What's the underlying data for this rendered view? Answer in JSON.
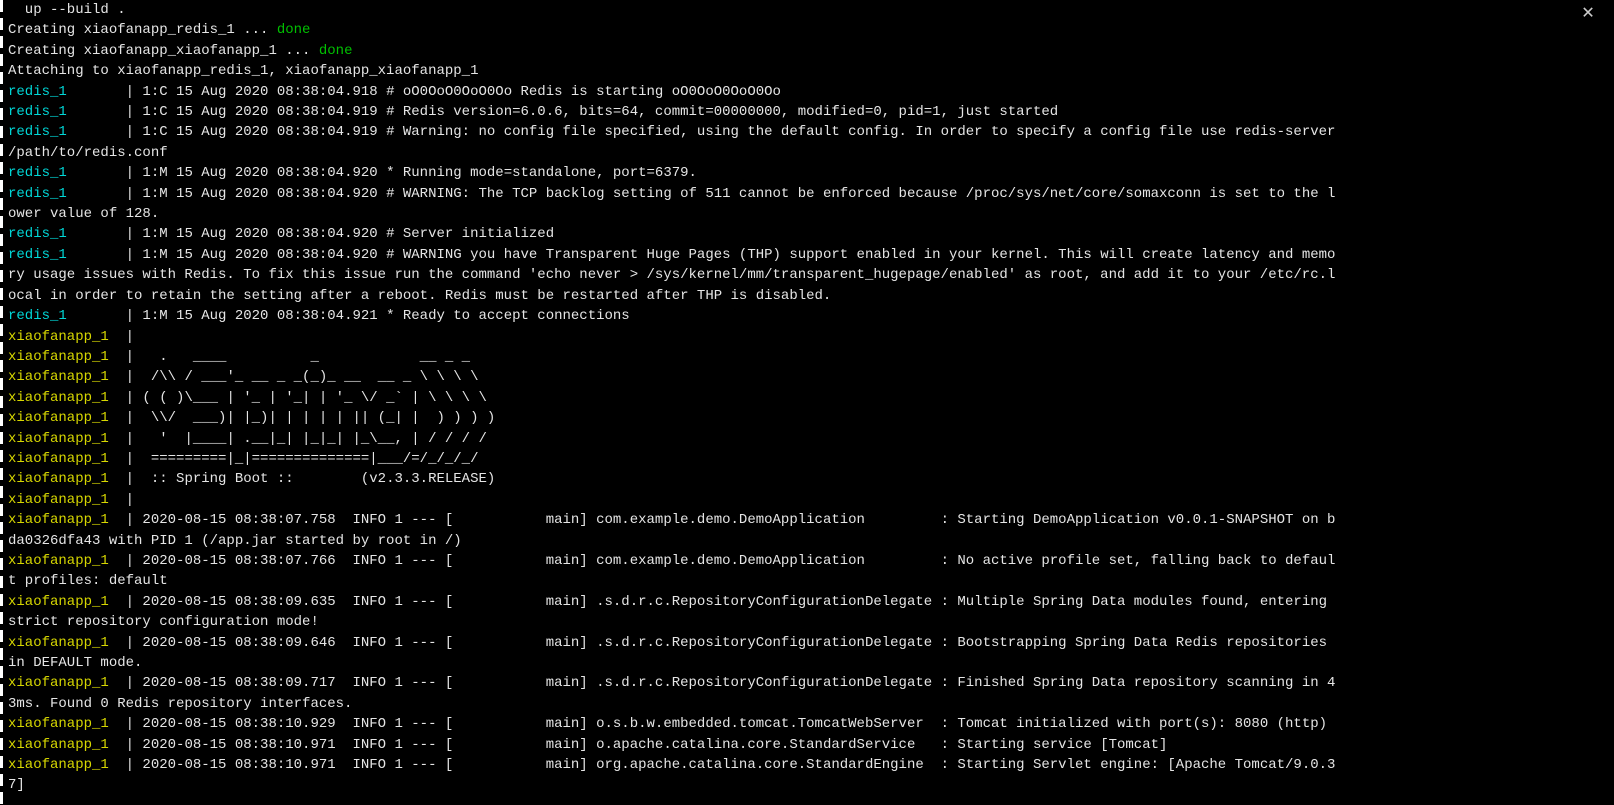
{
  "close_icon": "✕",
  "lines": [
    [
      {
        "cls": "white",
        "t": "  up --build ."
      }
    ],
    [
      {
        "cls": "white",
        "t": "Creating xiaofanapp_redis_1 ... "
      },
      {
        "cls": "green",
        "t": "done"
      }
    ],
    [
      {
        "cls": "white",
        "t": "Creating xiaofanapp_xiaofanapp_1 ... "
      },
      {
        "cls": "green",
        "t": "done"
      }
    ],
    [
      {
        "cls": "white",
        "t": "Attaching to xiaofanapp_redis_1, xiaofanapp_xiaofanapp_1"
      }
    ],
    [
      {
        "cls": "cyan",
        "t": "redis_1       "
      },
      {
        "cls": "white",
        "t": "|"
      },
      {
        "cls": "white",
        "t": " 1:C 15 Aug 2020 08:38:04.918 # oO0OoO0OoO0Oo Redis is starting oO0OoO0OoO0Oo"
      }
    ],
    [
      {
        "cls": "cyan",
        "t": "redis_1       "
      },
      {
        "cls": "white",
        "t": "|"
      },
      {
        "cls": "white",
        "t": " 1:C 15 Aug 2020 08:38:04.919 # Redis version=6.0.6, bits=64, commit=00000000, modified=0, pid=1, just started"
      }
    ],
    [
      {
        "cls": "cyan",
        "t": "redis_1       "
      },
      {
        "cls": "white",
        "t": "|"
      },
      {
        "cls": "white",
        "t": " 1:C 15 Aug 2020 08:38:04.919 # Warning: no config file specified, using the default config. In order to specify a config file use redis-server "
      }
    ],
    [
      {
        "cls": "white",
        "t": "/path/to/redis.conf"
      }
    ],
    [
      {
        "cls": "cyan",
        "t": "redis_1       "
      },
      {
        "cls": "white",
        "t": "|"
      },
      {
        "cls": "white",
        "t": " 1:M 15 Aug 2020 08:38:04.920 * Running mode=standalone, port=6379."
      }
    ],
    [
      {
        "cls": "cyan",
        "t": "redis_1       "
      },
      {
        "cls": "white",
        "t": "|"
      },
      {
        "cls": "white",
        "t": " 1:M 15 Aug 2020 08:38:04.920 # WARNING: The TCP backlog setting of 511 cannot be enforced because /proc/sys/net/core/somaxconn is set to the l"
      }
    ],
    [
      {
        "cls": "white",
        "t": "ower value of 128."
      }
    ],
    [
      {
        "cls": "cyan",
        "t": "redis_1       "
      },
      {
        "cls": "white",
        "t": "|"
      },
      {
        "cls": "white",
        "t": " 1:M 15 Aug 2020 08:38:04.920 # Server initialized"
      }
    ],
    [
      {
        "cls": "cyan",
        "t": "redis_1       "
      },
      {
        "cls": "white",
        "t": "|"
      },
      {
        "cls": "white",
        "t": " 1:M 15 Aug 2020 08:38:04.920 # WARNING you have Transparent Huge Pages (THP) support enabled in your kernel. This will create latency and memo"
      }
    ],
    [
      {
        "cls": "white",
        "t": "ry usage issues with Redis. To fix this issue run the command 'echo never > /sys/kernel/mm/transparent_hugepage/enabled' as root, and add it to your /etc/rc.l"
      }
    ],
    [
      {
        "cls": "white",
        "t": "ocal in order to retain the setting after a reboot. Redis must be restarted after THP is disabled."
      }
    ],
    [
      {
        "cls": "cyan",
        "t": "redis_1       "
      },
      {
        "cls": "white",
        "t": "|"
      },
      {
        "cls": "white",
        "t": " 1:M 15 Aug 2020 08:38:04.921 * Ready to accept connections"
      }
    ],
    [
      {
        "cls": "yellow",
        "t": "xiaofanapp_1  "
      },
      {
        "cls": "white",
        "t": "|"
      }
    ],
    [
      {
        "cls": "yellow",
        "t": "xiaofanapp_1  "
      },
      {
        "cls": "white",
        "t": "|"
      },
      {
        "cls": "white",
        "t": "   .   ____          _            __ _ _"
      }
    ],
    [
      {
        "cls": "yellow",
        "t": "xiaofanapp_1  "
      },
      {
        "cls": "white",
        "t": "|"
      },
      {
        "cls": "white",
        "t": "  /\\\\ / ___'_ __ _ _(_)_ __  __ _ \\ \\ \\ \\"
      }
    ],
    [
      {
        "cls": "yellow",
        "t": "xiaofanapp_1  "
      },
      {
        "cls": "white",
        "t": "|"
      },
      {
        "cls": "white",
        "t": " ( ( )\\___ | '_ | '_| | '_ \\/ _` | \\ \\ \\ \\"
      }
    ],
    [
      {
        "cls": "yellow",
        "t": "xiaofanapp_1  "
      },
      {
        "cls": "white",
        "t": "|"
      },
      {
        "cls": "white",
        "t": "  \\\\/  ___)| |_)| | | | | || (_| |  ) ) ) )"
      }
    ],
    [
      {
        "cls": "yellow",
        "t": "xiaofanapp_1  "
      },
      {
        "cls": "white",
        "t": "|"
      },
      {
        "cls": "white",
        "t": "   '  |____| .__|_| |_|_| |_\\__, | / / / /"
      }
    ],
    [
      {
        "cls": "yellow",
        "t": "xiaofanapp_1  "
      },
      {
        "cls": "white",
        "t": "|"
      },
      {
        "cls": "white",
        "t": "  =========|_|==============|___/=/_/_/_/"
      }
    ],
    [
      {
        "cls": "yellow",
        "t": "xiaofanapp_1  "
      },
      {
        "cls": "white",
        "t": "|"
      },
      {
        "cls": "white",
        "t": "  :: Spring Boot ::        (v2.3.3.RELEASE)"
      }
    ],
    [
      {
        "cls": "yellow",
        "t": "xiaofanapp_1  "
      },
      {
        "cls": "white",
        "t": "|"
      }
    ],
    [
      {
        "cls": "yellow",
        "t": "xiaofanapp_1  "
      },
      {
        "cls": "white",
        "t": "|"
      },
      {
        "cls": "white",
        "t": " 2020-08-15 08:38:07.758  INFO 1 --- [           main] com.example.demo.DemoApplication         : Starting DemoApplication v0.0.1-SNAPSHOT on b"
      }
    ],
    [
      {
        "cls": "white",
        "t": "da0326dfa43 with PID 1 (/app.jar started by root in /)"
      }
    ],
    [
      {
        "cls": "yellow",
        "t": "xiaofanapp_1  "
      },
      {
        "cls": "white",
        "t": "|"
      },
      {
        "cls": "white",
        "t": " 2020-08-15 08:38:07.766  INFO 1 --- [           main] com.example.demo.DemoApplication         : No active profile set, falling back to defaul"
      }
    ],
    [
      {
        "cls": "white",
        "t": "t profiles: default"
      }
    ],
    [
      {
        "cls": "yellow",
        "t": "xiaofanapp_1  "
      },
      {
        "cls": "white",
        "t": "|"
      },
      {
        "cls": "white",
        "t": " 2020-08-15 08:38:09.635  INFO 1 --- [           main] .s.d.r.c.RepositoryConfigurationDelegate : Multiple Spring Data modules found, entering "
      }
    ],
    [
      {
        "cls": "white",
        "t": "strict repository configuration mode!"
      }
    ],
    [
      {
        "cls": "yellow",
        "t": "xiaofanapp_1  "
      },
      {
        "cls": "white",
        "t": "|"
      },
      {
        "cls": "white",
        "t": " 2020-08-15 08:38:09.646  INFO 1 --- [           main] .s.d.r.c.RepositoryConfigurationDelegate : Bootstrapping Spring Data Redis repositories "
      }
    ],
    [
      {
        "cls": "white",
        "t": "in DEFAULT mode."
      }
    ],
    [
      {
        "cls": "yellow",
        "t": "xiaofanapp_1  "
      },
      {
        "cls": "white",
        "t": "|"
      },
      {
        "cls": "white",
        "t": " 2020-08-15 08:38:09.717  INFO 1 --- [           main] .s.d.r.c.RepositoryConfigurationDelegate : Finished Spring Data repository scanning in 4"
      }
    ],
    [
      {
        "cls": "white",
        "t": "3ms. Found 0 Redis repository interfaces."
      }
    ],
    [
      {
        "cls": "yellow",
        "t": "xiaofanapp_1  "
      },
      {
        "cls": "white",
        "t": "|"
      },
      {
        "cls": "white",
        "t": " 2020-08-15 08:38:10.929  INFO 1 --- [           main] o.s.b.w.embedded.tomcat.TomcatWebServer  : Tomcat initialized with port(s): 8080 (http)"
      }
    ],
    [
      {
        "cls": "yellow",
        "t": "xiaofanapp_1  "
      },
      {
        "cls": "white",
        "t": "|"
      },
      {
        "cls": "white",
        "t": " 2020-08-15 08:38:10.971  INFO 1 --- [           main] o.apache.catalina.core.StandardService   : Starting service [Tomcat]"
      }
    ],
    [
      {
        "cls": "yellow",
        "t": "xiaofanapp_1  "
      },
      {
        "cls": "white",
        "t": "|"
      },
      {
        "cls": "white",
        "t": " 2020-08-15 08:38:10.971  INFO 1 --- [           main] org.apache.catalina.core.StandardEngine  : Starting Servlet engine: [Apache Tomcat/9.0.3"
      }
    ],
    [
      {
        "cls": "white",
        "t": "7]"
      }
    ]
  ]
}
